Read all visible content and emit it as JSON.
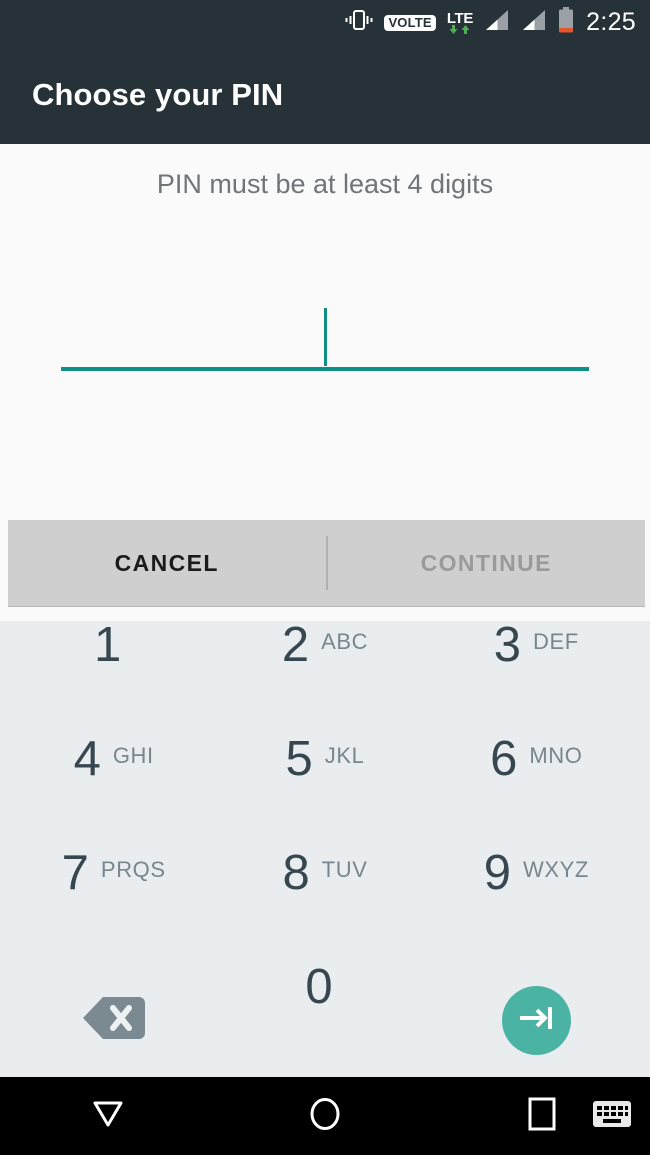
{
  "status_bar": {
    "vibrate_icon": "vibrate-icon",
    "volte_label": "VOLTE",
    "network_label": "LTE",
    "data_arrows_icon": "data-transfer-arrows-icon",
    "signal_1_icon": "signal-bars-icon",
    "signal_2_icon": "signal-bars-icon",
    "battery_icon": "battery-low-icon",
    "time": "2:25"
  },
  "header": {
    "title": "Choose your PIN"
  },
  "content": {
    "hint": "PIN must be at least 4 digits",
    "pin_value": "",
    "caret_visible": true,
    "accent_color": "#109085"
  },
  "actions": {
    "cancel_label": "CANCEL",
    "continue_label": "CONTINUE",
    "continue_enabled": false
  },
  "keypad": {
    "keys": [
      {
        "digit": "1",
        "letters": ""
      },
      {
        "digit": "2",
        "letters": "ABC"
      },
      {
        "digit": "3",
        "letters": "DEF"
      },
      {
        "digit": "4",
        "letters": "GHI"
      },
      {
        "digit": "5",
        "letters": "JKL"
      },
      {
        "digit": "6",
        "letters": "MNO"
      },
      {
        "digit": "7",
        "letters": "PRQS"
      },
      {
        "digit": "8",
        "letters": "TUV"
      },
      {
        "digit": "9",
        "letters": "WXYZ"
      },
      {
        "digit": "0",
        "letters": ""
      }
    ],
    "backspace_icon": "backspace-icon",
    "next_icon": "arrow-next-icon",
    "next_color": "#4bb3a3",
    "background_color": "#e9edf0"
  },
  "nav_bar": {
    "back_icon": "collapse-keyboard-icon",
    "home_icon": "home-circle-icon",
    "recents_icon": "recents-square-icon",
    "keyboard_icon": "keyboard-switch-icon"
  }
}
